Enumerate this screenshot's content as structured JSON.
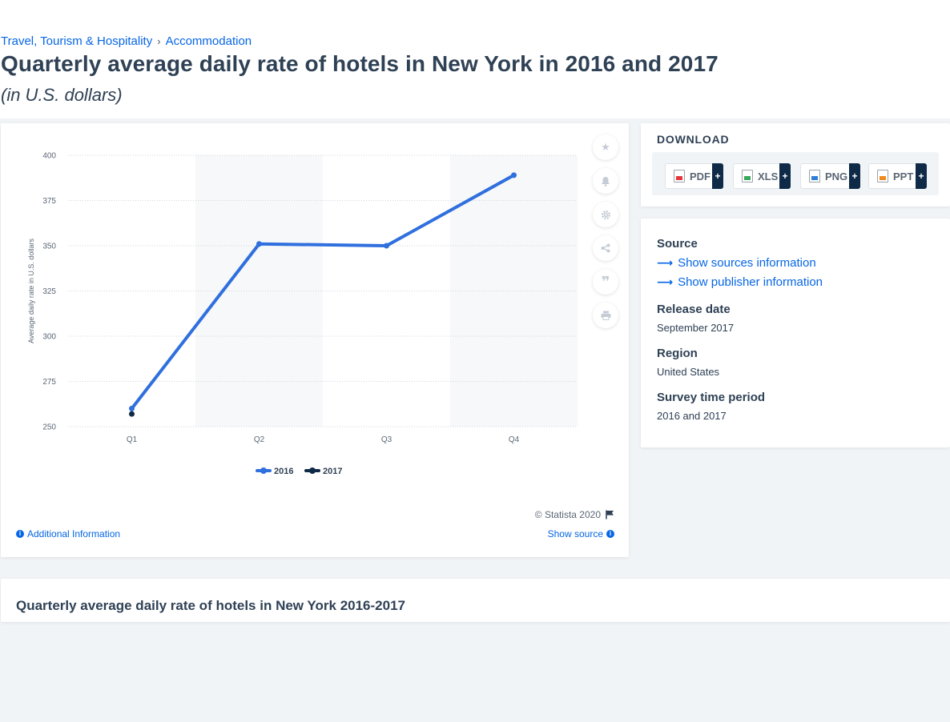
{
  "breadcrumb": {
    "items": [
      "Travel, Tourism & Hospitality",
      "Accommodation"
    ],
    "separator": "›"
  },
  "page": {
    "title": "Quarterly average daily rate of hotels in New York in 2016 and 2017",
    "subtitle": "(in U.S. dollars)"
  },
  "chart_data": {
    "type": "line",
    "categories": [
      "Q1",
      "Q2",
      "Q3",
      "Q4"
    ],
    "series": [
      {
        "name": "2016",
        "values": [
          260,
          351,
          350,
          389
        ],
        "color": "#2f6fde"
      },
      {
        "name": "2017",
        "values": [
          257,
          null,
          null,
          null
        ],
        "color": "#0e2a47"
      }
    ],
    "ylabel": "Average daily rate in U.S. dollars",
    "yticks": [
      250,
      275,
      300,
      325,
      350,
      375,
      400
    ],
    "ylim": [
      250,
      400
    ],
    "grid": "dashed horizontal",
    "legend_position": "bottom-center"
  },
  "chart_footer": {
    "copyright": "© Statista 2020",
    "additional_info": "Additional Information",
    "show_source": "Show source"
  },
  "download": {
    "title": "DOWNLOAD",
    "formats": [
      "PDF",
      "XLS",
      "PNG",
      "PPT"
    ],
    "plus": "+"
  },
  "info": {
    "source_label": "Source",
    "show_sources": "Show sources information",
    "show_publisher": "Show publisher information",
    "release_label": "Release date",
    "release_value": "September 2017",
    "region_label": "Region",
    "region_value": "United States",
    "survey_label": "Survey time period",
    "survey_value": "2016 and 2017"
  },
  "bottom": {
    "title": "Quarterly average daily rate of hotels in New York 2016-2017"
  }
}
